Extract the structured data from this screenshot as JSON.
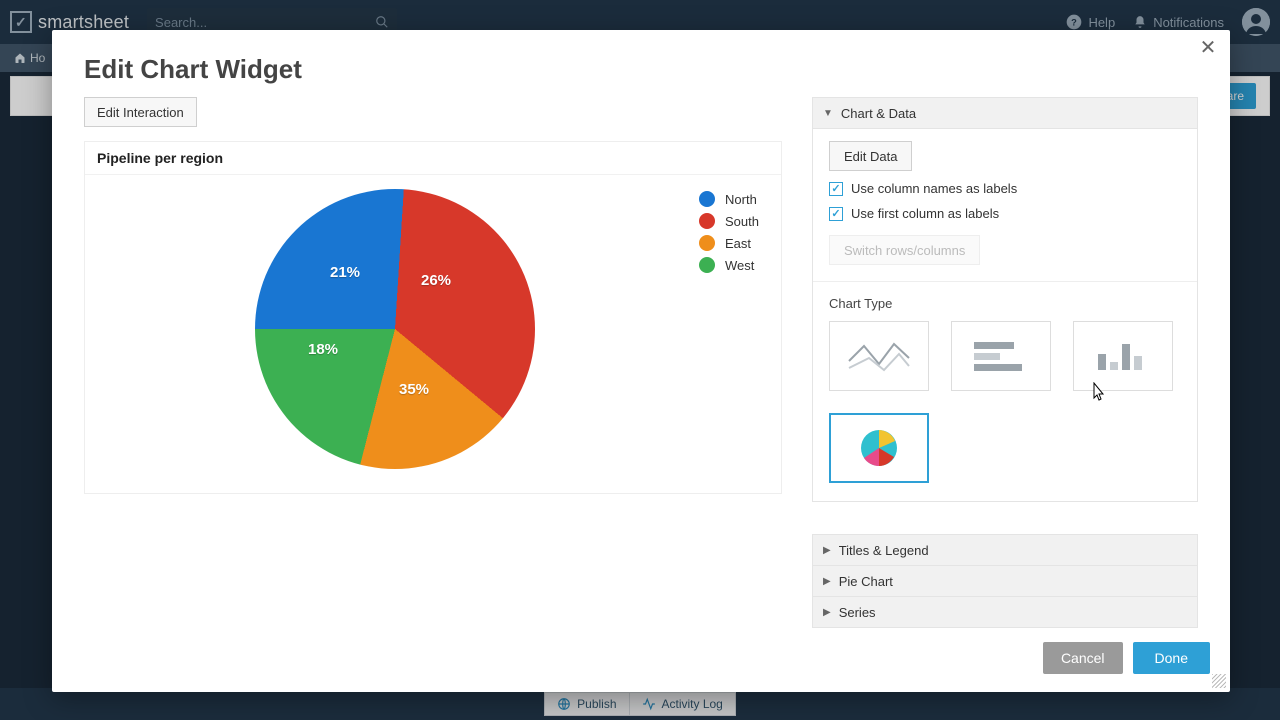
{
  "app": {
    "name": "smartsheet",
    "search_placeholder": "Search..."
  },
  "topbar": {
    "help": "Help",
    "notifications": "Notifications"
  },
  "breadcrumb": {
    "home": "Ho"
  },
  "background": {
    "share": "are",
    "publish": "Publish",
    "activity_log": "Activity Log"
  },
  "modal": {
    "title": "Edit Chart Widget",
    "edit_interaction": "Edit Interaction",
    "cancel": "Cancel",
    "done": "Done"
  },
  "chart": {
    "title": "Pipeline per region",
    "legend": [
      "North",
      "South",
      "East",
      "West"
    ]
  },
  "chart_data": {
    "type": "pie",
    "title": "Pipeline per region",
    "categories": [
      "North",
      "South",
      "East",
      "West"
    ],
    "values": [
      26,
      35,
      18,
      21
    ],
    "value_labels": [
      "26%",
      "35%",
      "18%",
      "21%"
    ],
    "colors": [
      "#1976d2",
      "#d7382a",
      "#ef8e1b",
      "#3cb052"
    ],
    "legend_position": "right"
  },
  "panel": {
    "sections": {
      "chart_data": "Chart & Data",
      "titles_legend": "Titles & Legend",
      "pie_chart": "Pie Chart",
      "series": "Series"
    },
    "edit_data": "Edit Data",
    "use_col_names": "Use column names as labels",
    "use_first_col": "Use first column as labels",
    "switch": "Switch rows/columns",
    "chart_type": "Chart Type"
  }
}
